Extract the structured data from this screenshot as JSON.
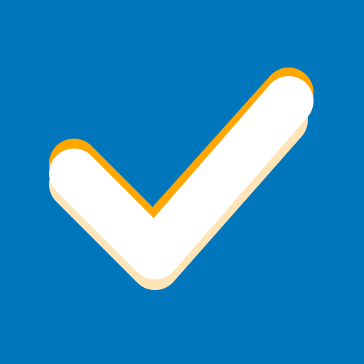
{
  "icon": {
    "name": "checkmark-icon",
    "colors": {
      "background": "#0077BC",
      "check_fill": "#FFFFFF",
      "top_edge": "#FFA600",
      "bottom_shadow": "#FFE4B8"
    }
  }
}
